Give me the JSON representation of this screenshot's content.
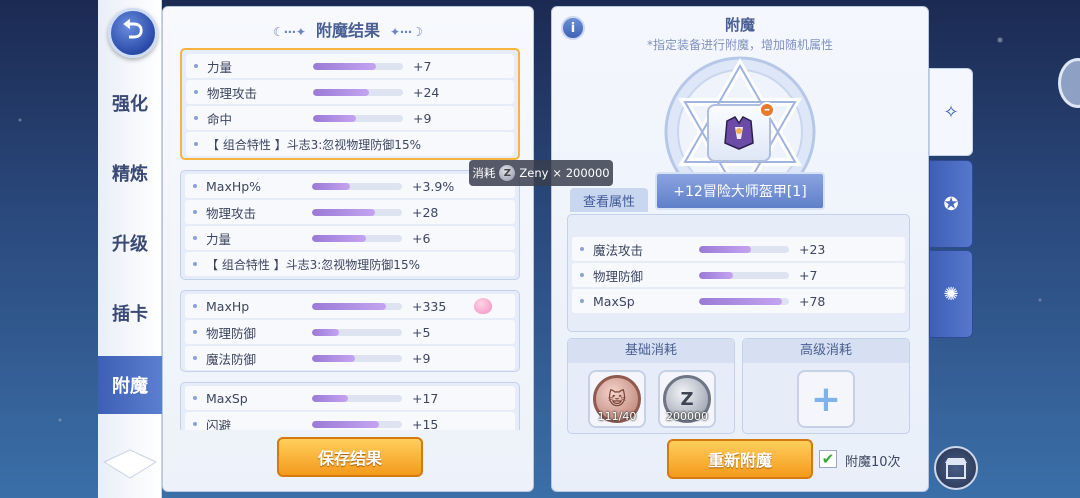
{
  "nav": {
    "back_icon": "back-arrow-icon",
    "items": [
      {
        "label": "强化",
        "active": false
      },
      {
        "label": "精炼",
        "active": false
      },
      {
        "label": "升级",
        "active": false
      },
      {
        "label": "插卡",
        "active": false
      },
      {
        "label": "附魔",
        "active": true
      }
    ]
  },
  "left_panel": {
    "title": "附魔结果",
    "groups": [
      {
        "selected": true,
        "rows": [
          {
            "name": "力量",
            "fill": 0.7,
            "value": "+7"
          },
          {
            "name": "物理攻击",
            "fill": 0.62,
            "value": "+24"
          },
          {
            "name": "命中",
            "fill": 0.48,
            "value": "+9"
          },
          {
            "trait": "【 组合特性 】斗志3:忽视物理防御15%"
          }
        ]
      },
      {
        "selected": false,
        "rows": [
          {
            "name": "MaxHp%",
            "fill": 0.42,
            "value": "+3.9%"
          },
          {
            "name": "物理攻击",
            "fill": 0.7,
            "value": "+28"
          },
          {
            "name": "力量",
            "fill": 0.6,
            "value": "+6"
          },
          {
            "trait": "【 组合特性 】斗志3:忽视物理防御15%"
          }
        ]
      },
      {
        "selected": false,
        "rows": [
          {
            "name": "MaxHp",
            "fill": 0.82,
            "value": "+335",
            "badge": "pink-poring-icon"
          },
          {
            "name": "物理防御",
            "fill": 0.3,
            "value": "+5"
          },
          {
            "name": "魔法防御",
            "fill": 0.48,
            "value": "+9"
          }
        ]
      },
      {
        "selected": false,
        "rows": [
          {
            "name": "MaxSp",
            "fill": 0.4,
            "value": "+17"
          },
          {
            "name": "闪避",
            "fill": 0.74,
            "value": "+15"
          }
        ]
      }
    ],
    "save_label": "保存结果"
  },
  "tooltip": {
    "prefix": "消耗",
    "currency": "Zeny",
    "amount": "× 200000"
  },
  "right_panel": {
    "title": "附魔",
    "subtitle": "*指定装备进行附魔，增加随机属性",
    "item_name": "+12冒险大师盔甲[1]",
    "view_attr_label": "查看属性",
    "attributes": [
      {
        "name": "魔法攻击",
        "fill": 0.58,
        "value": "+23"
      },
      {
        "name": "物理防御",
        "fill": 0.38,
        "value": "+7"
      },
      {
        "name": "MaxSp",
        "fill": 0.92,
        "value": "+78"
      }
    ],
    "basic_cost_title": "基础消耗",
    "advanced_cost_title": "高级消耗",
    "basic_costs": [
      {
        "icon": "cat-token-icon",
        "label": "111/40"
      },
      {
        "icon": "zeny-coin-icon",
        "label": "200000"
      }
    ],
    "reroll_label": "重新附魔",
    "enchant_x10_label": "附魔10次",
    "enchant_x10_checked": true
  },
  "side_tabs": [
    "enchant-star-icon",
    "enchant-orb-icon",
    "enchant-gear-icon"
  ],
  "colors": {
    "accent": "#3d5fb5",
    "button": "#f49a1c",
    "bar": "#b28de6",
    "selected_border": "#f5b440"
  }
}
